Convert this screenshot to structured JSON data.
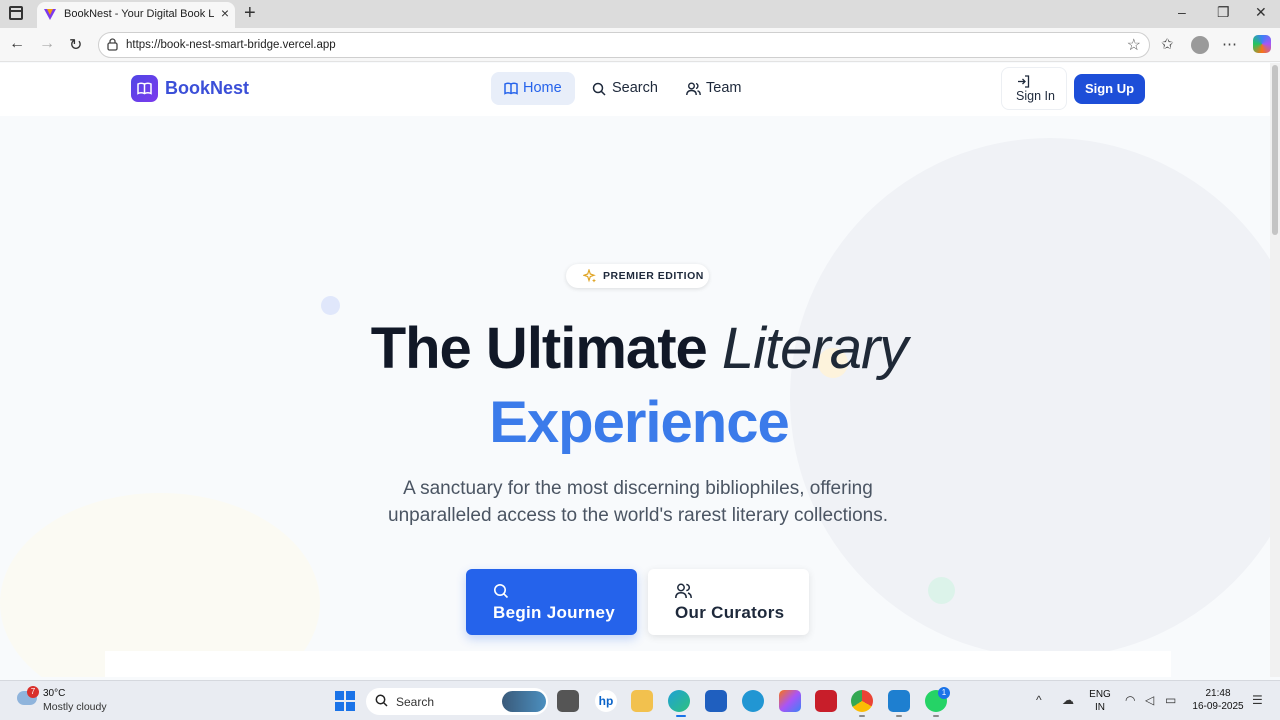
{
  "browser": {
    "tab_title": "BookNest - Your Digital Book Library",
    "url": "https://book-nest-smart-bridge.vercel.app"
  },
  "header": {
    "logo": "BookNest",
    "nav": [
      {
        "label": "Home",
        "icon": "book-open-icon",
        "active": true
      },
      {
        "label": "Search",
        "icon": "search-icon",
        "active": false
      },
      {
        "label": "Team",
        "icon": "users-icon",
        "active": false
      }
    ],
    "sign_in": "Sign In",
    "sign_up": "Sign Up"
  },
  "hero": {
    "badge": "PREMIER EDITION",
    "title_bold": "The Ultimate",
    "title_italic": "Literary",
    "title_accent": "Experience",
    "subtitle": "A sanctuary for the most discerning bibliophiles, offering unparalleled access to the world's rarest literary collections.",
    "primary_button": "Begin Journey",
    "secondary_button": "Our Curators"
  },
  "colors": {
    "brand": "#3b4fd8",
    "accent": "#3b7bea",
    "primary_button": "#2563eb",
    "signup_button": "#1d4ed8"
  },
  "taskbar": {
    "weather_temp": "30°C",
    "weather_desc": "Mostly cloudy",
    "weather_alert": "7",
    "search": "Search",
    "lang_top": "ENG",
    "lang_bottom": "IN",
    "time": "21:48",
    "date": "16-09-2025",
    "whatsapp_badge": "1"
  }
}
